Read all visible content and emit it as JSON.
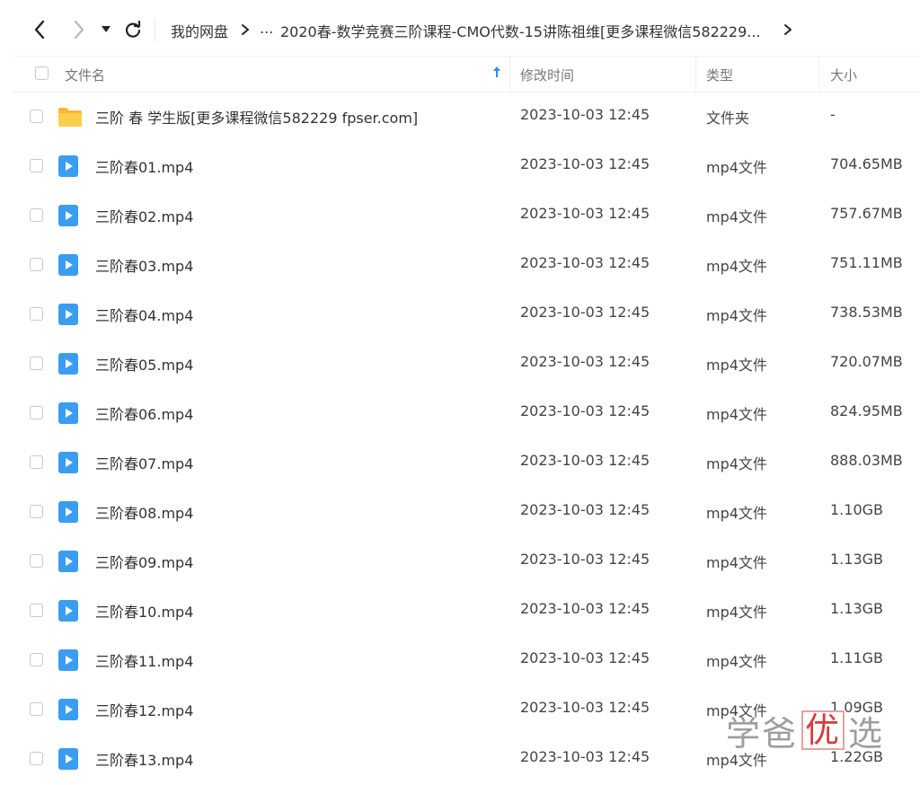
{
  "toolbar": {
    "breadcrumb": [
      {
        "label": "我的网盘"
      },
      {
        "label": "..."
      },
      {
        "label": "2020春-数学竞赛三阶课程-CMO代数-15讲陈祖维[更多课程微信582229..."
      }
    ]
  },
  "columns": {
    "name": "文件名",
    "modified": "修改时间",
    "type": "类型",
    "size": "大小"
  },
  "files": [
    {
      "icon": "folder-icon",
      "name": "三阶 春 学生版[更多课程微信582229 fpser.com]",
      "modified": "2023-10-03 12:45",
      "type": "文件夹",
      "size": "-"
    },
    {
      "icon": "video-icon",
      "name": "三阶春01.mp4",
      "modified": "2023-10-03 12:45",
      "type": "mp4文件",
      "size": "704.65MB"
    },
    {
      "icon": "video-icon",
      "name": "三阶春02.mp4",
      "modified": "2023-10-03 12:45",
      "type": "mp4文件",
      "size": "757.67MB"
    },
    {
      "icon": "video-icon",
      "name": "三阶春03.mp4",
      "modified": "2023-10-03 12:45",
      "type": "mp4文件",
      "size": "751.11MB"
    },
    {
      "icon": "video-icon",
      "name": "三阶春04.mp4",
      "modified": "2023-10-03 12:45",
      "type": "mp4文件",
      "size": "738.53MB"
    },
    {
      "icon": "video-icon",
      "name": "三阶春05.mp4",
      "modified": "2023-10-03 12:45",
      "type": "mp4文件",
      "size": "720.07MB"
    },
    {
      "icon": "video-icon",
      "name": "三阶春06.mp4",
      "modified": "2023-10-03 12:45",
      "type": "mp4文件",
      "size": "824.95MB"
    },
    {
      "icon": "video-icon",
      "name": "三阶春07.mp4",
      "modified": "2023-10-03 12:45",
      "type": "mp4文件",
      "size": "888.03MB"
    },
    {
      "icon": "video-icon",
      "name": "三阶春08.mp4",
      "modified": "2023-10-03 12:45",
      "type": "mp4文件",
      "size": "1.10GB"
    },
    {
      "icon": "video-icon",
      "name": "三阶春09.mp4",
      "modified": "2023-10-03 12:45",
      "type": "mp4文件",
      "size": "1.13GB"
    },
    {
      "icon": "video-icon",
      "name": "三阶春10.mp4",
      "modified": "2023-10-03 12:45",
      "type": "mp4文件",
      "size": "1.13GB"
    },
    {
      "icon": "video-icon",
      "name": "三阶春11.mp4",
      "modified": "2023-10-03 12:45",
      "type": "mp4文件",
      "size": "1.11GB"
    },
    {
      "icon": "video-icon",
      "name": "三阶春12.mp4",
      "modified": "2023-10-03 12:45",
      "type": "mp4文件",
      "size": "1.09GB"
    },
    {
      "icon": "video-icon",
      "name": "三阶春13.mp4",
      "modified": "2023-10-03 12:45",
      "type": "mp4文件",
      "size": "1.22GB"
    }
  ],
  "watermark": {
    "part1": "学爸",
    "part2": "优",
    "part3": "选"
  },
  "colors": {
    "folder": "#f9c53d",
    "video": "#3b9df2",
    "sort_arrow": "#2e8de6"
  }
}
